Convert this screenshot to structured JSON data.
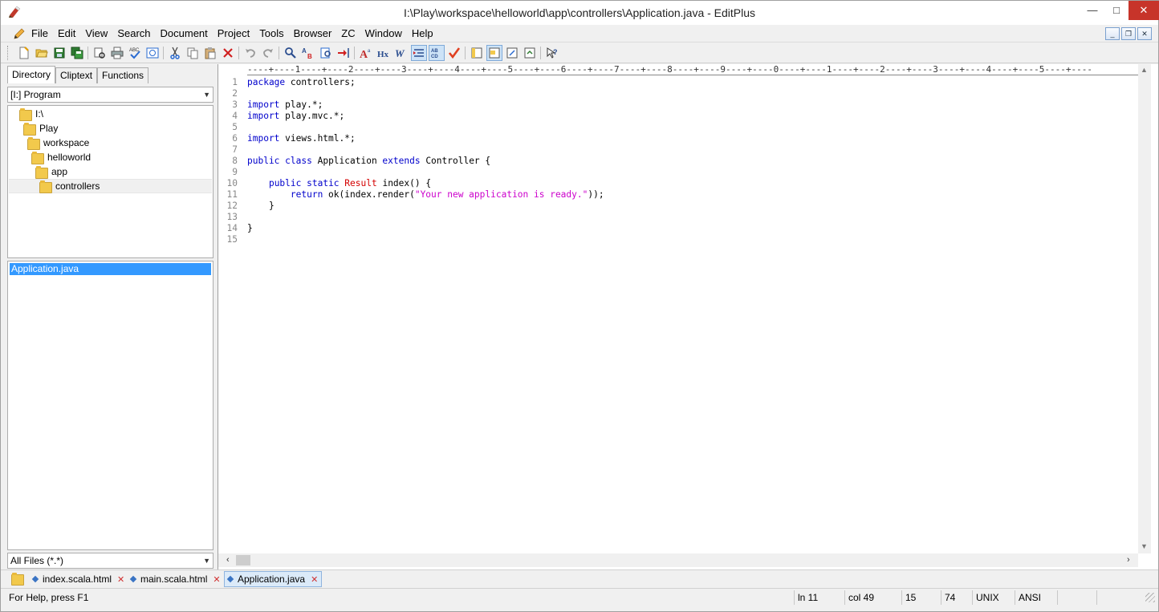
{
  "window": {
    "title": "I:\\Play\\workspace\\helloworld\\app\\controllers\\Application.java - EditPlus",
    "app_icon": "editplus-icon",
    "controls": {
      "minimize": "—",
      "maximize": "□",
      "close": "✕"
    }
  },
  "menu": {
    "items": [
      "File",
      "Edit",
      "View",
      "Search",
      "Document",
      "Project",
      "Tools",
      "Browser",
      "ZC",
      "Window",
      "Help"
    ],
    "mdi": {
      "minimize": "_",
      "restore": "❐",
      "close": "✕"
    }
  },
  "toolbar": {
    "buttons": [
      "new-file-icon",
      "open-file-icon",
      "save-icon",
      "save-all-icon",
      "print-preview-icon",
      "print-icon",
      "spell-check-icon",
      "browser-preview-icon",
      "cut-icon",
      "copy-icon",
      "paste-icon",
      "delete-icon",
      "undo-icon",
      "redo-icon",
      "find-icon",
      "replace-icon",
      "find-in-files-icon",
      "goto-icon",
      "font-icon",
      "hex-icon",
      "word-wrap-icon",
      "line-number-icon",
      "ruler-icon",
      "spell-icon",
      "cliptext-window-icon",
      "directory-window-icon",
      "output-window-icon",
      "function-list-icon",
      "help-icon"
    ],
    "active": [
      "line-number-icon",
      "ruler-icon",
      "directory-window-icon"
    ]
  },
  "left_panel": {
    "tabs": [
      {
        "label": "Directory",
        "active": true
      },
      {
        "label": "Cliptext",
        "active": false
      },
      {
        "label": "Functions",
        "active": false
      }
    ],
    "drive_select": "[I:] Program",
    "tree": [
      {
        "label": "I:\\",
        "depth": 0
      },
      {
        "label": "Play",
        "depth": 1
      },
      {
        "label": "workspace",
        "depth": 2
      },
      {
        "label": "helloworld",
        "depth": 3
      },
      {
        "label": "app",
        "depth": 4
      },
      {
        "label": "controllers",
        "depth": 5,
        "selected": true
      }
    ],
    "files": [
      "Application.java"
    ],
    "filter_select": "All Files (*.*)"
  },
  "editor": {
    "ruler": "----+----1----+----2----+----3----+----4----+----5----+----6----+----7----+----8----+----9----+----0----+----1----+----2----+----3----+----4----+----5----+----",
    "lines": [
      {
        "n": "1",
        "text": "package controllers;"
      },
      {
        "n": "2",
        "text": ""
      },
      {
        "n": "3",
        "text": "import play.*;"
      },
      {
        "n": "4",
        "text": "import play.mvc.*;"
      },
      {
        "n": "5",
        "text": ""
      },
      {
        "n": "6",
        "text": "import views.html.*;"
      },
      {
        "n": "7",
        "text": ""
      },
      {
        "n": "8",
        "text": "public class Application extends Controller {"
      },
      {
        "n": "9",
        "text": ""
      },
      {
        "n": "10",
        "text": "    public static Result index() {"
      },
      {
        "n": "11",
        "text": "        return ok(index.render(\"Your new application is ready.\"));"
      },
      {
        "n": "12",
        "text": "    }"
      },
      {
        "n": "13",
        "text": ""
      },
      {
        "n": "14",
        "text": "}"
      },
      {
        "n": "15",
        "text": ""
      }
    ],
    "colors": {
      "keyword": "#0000cc",
      "type": "#d40000",
      "string": "#cc00cc"
    }
  },
  "doc_tabs": [
    {
      "label": "index.scala.html",
      "active": false
    },
    {
      "label": "main.scala.html",
      "active": false
    },
    {
      "label": "Application.java",
      "active": true
    }
  ],
  "status": {
    "help": "For Help, press F1",
    "ln": "ln 11",
    "col": "col 49",
    "lines": "15",
    "chars": "74",
    "format": "UNIX",
    "encoding": "ANSI"
  }
}
